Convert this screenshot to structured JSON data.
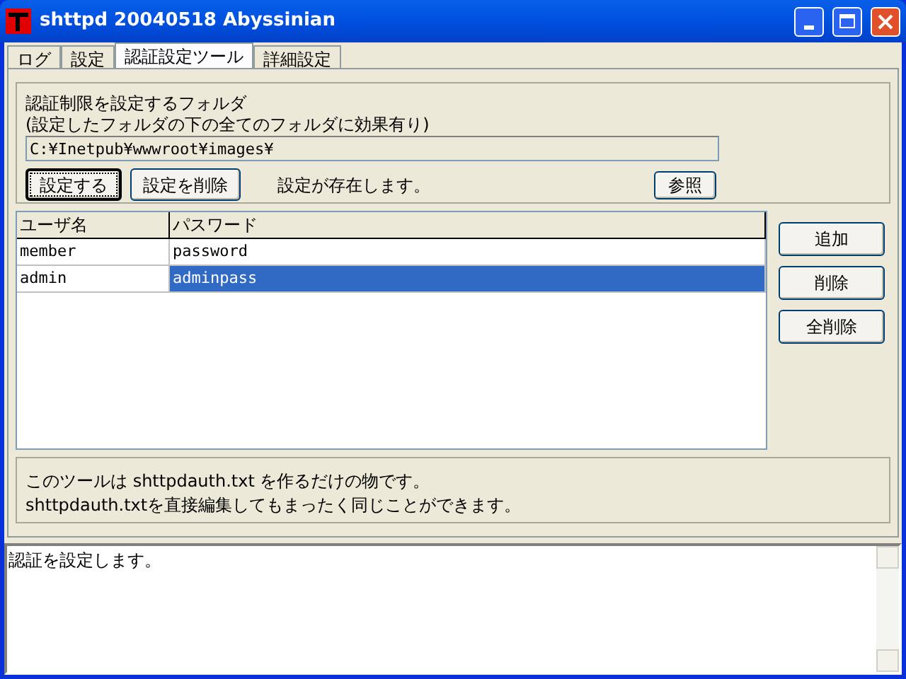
{
  "window": {
    "title": "shttpd 20040518 Abyssinian"
  },
  "tabs": [
    {
      "label": "ログ",
      "selected": false
    },
    {
      "label": "設定",
      "selected": false
    },
    {
      "label": "認証設定ツール",
      "selected": true
    },
    {
      "label": "詳細設定",
      "selected": false
    }
  ],
  "folder": {
    "label": "認証制限を設定するフォルダ",
    "note": "(設定したフォルダの下の全てのフォルダに効果有り)",
    "value": "C:¥Inetpub¥wwwroot¥images¥"
  },
  "folder_buttons": [
    {
      "label": "設定する",
      "focused": true
    },
    {
      "label": "設定を削除",
      "focused": false
    }
  ],
  "status": "設定が存在します。",
  "browse_button": "参照",
  "table": {
    "columns": [
      "ユーザ名",
      "パスワード"
    ],
    "rows": [
      {
        "cells": [
          "member",
          "password"
        ],
        "selected": false
      },
      {
        "cells": [
          "admin",
          "adminpass"
        ],
        "selected": true
      }
    ]
  },
  "side_buttons": [
    "追加",
    "削除",
    "全削除"
  ],
  "info": [
    "このツールは shttpdauth.txt を作るだけの物です。",
    "shttpdauth.txtを直接編集してもまったく同じことができます。"
  ],
  "log": "認証を設定します。"
}
